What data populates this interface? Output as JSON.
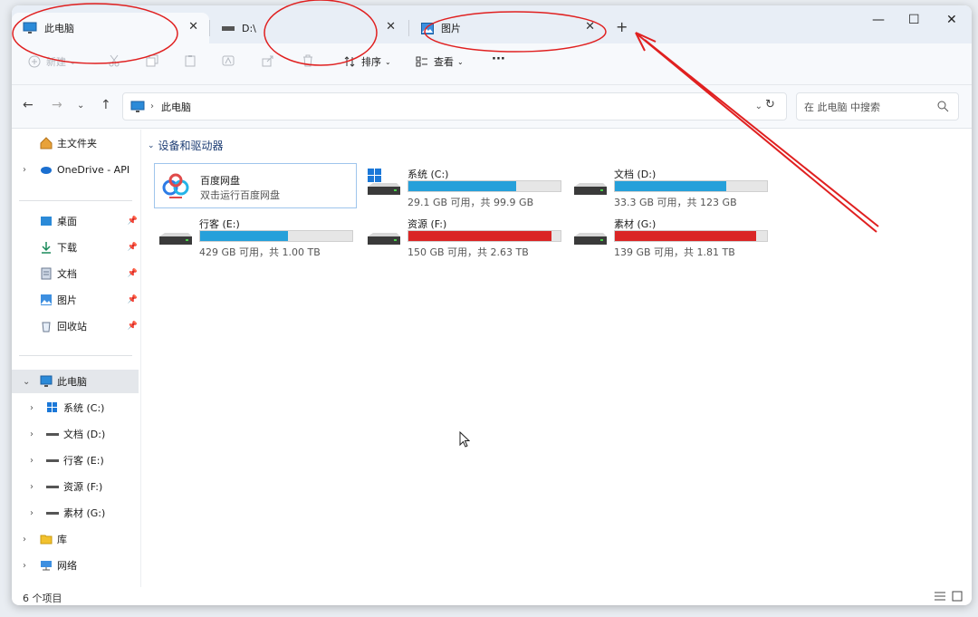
{
  "tabs": [
    {
      "label": "此电脑",
      "close": "✕"
    },
    {
      "label": "D:\\",
      "close": "✕"
    },
    {
      "label": "图片",
      "close": "✕"
    }
  ],
  "new_tab": "+",
  "window_controls": {
    "minimize": "—",
    "maximize": "☐",
    "close": "✕"
  },
  "toolbar": {
    "new_label": "新建",
    "sort_label": "排序",
    "view_label": "查看",
    "more_label": "···"
  },
  "address": {
    "location": "此电脑"
  },
  "search": {
    "placeholder": "在 此电脑 中搜索"
  },
  "sidebar": {
    "home": "主文件夹",
    "onedrive": "OneDrive - API",
    "quick": [
      {
        "label": "桌面"
      },
      {
        "label": "下载"
      },
      {
        "label": "文档"
      },
      {
        "label": "图片"
      },
      {
        "label": "回收站"
      }
    ],
    "this_pc": "此电脑",
    "drives": [
      {
        "label": "系统 (C:)"
      },
      {
        "label": "文档 (D:)"
      },
      {
        "label": "行客 (E:)"
      },
      {
        "label": "资源 (F:)"
      },
      {
        "label": "素材 (G:)"
      }
    ],
    "library": "库",
    "network": "网络"
  },
  "content": {
    "group_title": "设备和驱动器",
    "baidu": {
      "name": "百度网盘",
      "desc": "双击运行百度网盘"
    },
    "drives": [
      {
        "name": "系统 (C:)",
        "size": "29.1 GB 可用，共 99.9 GB",
        "used_fraction": 0.71,
        "color": "#26a0da"
      },
      {
        "name": "文档 (D:)",
        "size": "33.3 GB 可用，共 123 GB",
        "used_fraction": 0.73,
        "color": "#26a0da"
      },
      {
        "name": "行客 (E:)",
        "size": "429 GB 可用，共 1.00 TB",
        "used_fraction": 0.58,
        "color": "#26a0da"
      },
      {
        "name": "资源 (F:)",
        "size": "150 GB 可用，共 2.63 TB",
        "used_fraction": 0.94,
        "color": "#da2626"
      },
      {
        "name": "素材 (G:)",
        "size": "139 GB 可用，共 1.81 TB",
        "used_fraction": 0.93,
        "color": "#da2626"
      }
    ]
  },
  "status": {
    "count": "6 个项目"
  },
  "annotation_color": "#e02020"
}
